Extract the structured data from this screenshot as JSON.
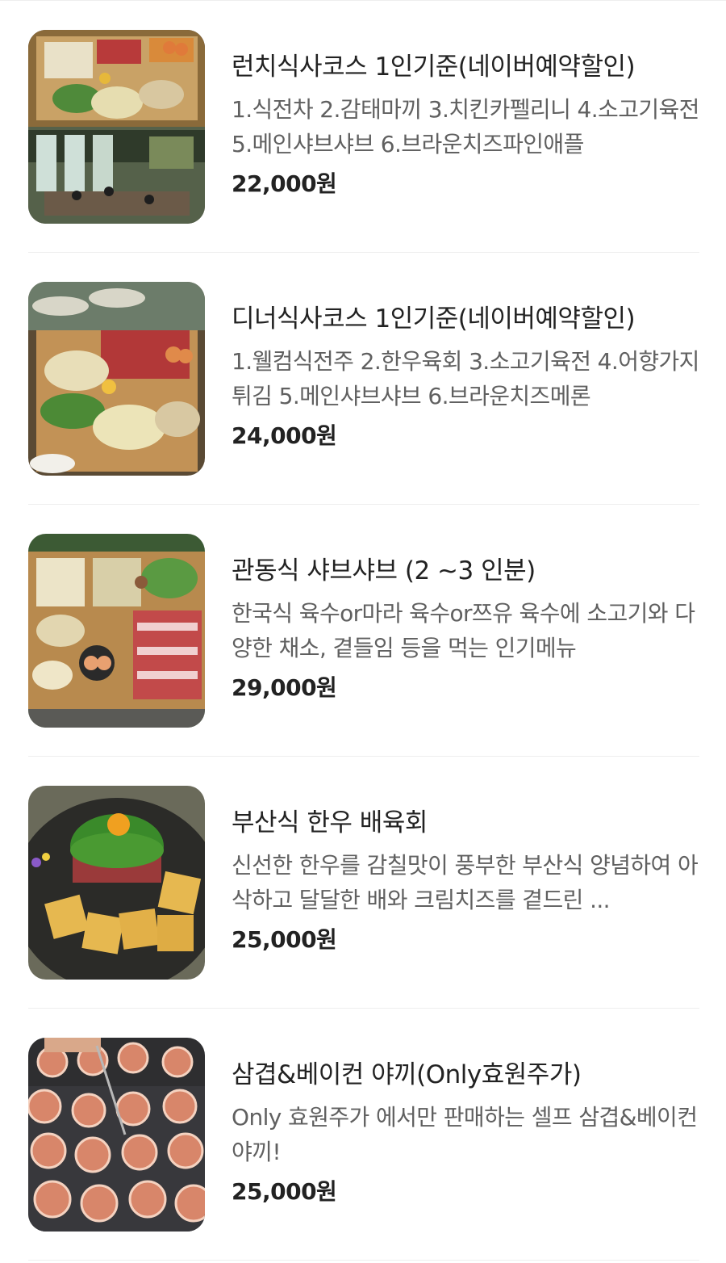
{
  "menu": {
    "items": [
      {
        "title": "런치식사코스 1인기준(네이버예약할인)",
        "description": "1.식전차 2.감태마끼 3.치킨카펠리니 4.소고기육전 5.메인샤브샤브 6.브라운치즈파인애플",
        "price": "22,000원",
        "image": "lunch-course-photo"
      },
      {
        "title": "디너식사코스 1인기준(네이버예약할인)",
        "description": "1.웰컴식전주 2.한우육회 3.소고기육전 4.어향가지튀김 5.메인샤브샤브 6.브라운치즈메론",
        "price": "24,000원",
        "image": "dinner-course-photo"
      },
      {
        "title": "관동식 샤브샤브 (2 ~3 인분)",
        "description": "한국식 육수or마라 육수or쯔유 육수에 소고기와 다양한 채소, 곁들임 등을 먹는 인기메뉴",
        "price": "29,000원",
        "image": "shabu-shabu-photo"
      },
      {
        "title": "부산식 한우 배육회",
        "description": "신선한 한우를 감칠맛이 풍부한 부산식 양념하여 아삭하고 달달한 배와 크림치즈를 곁드린 ...",
        "price": "25,000원",
        "image": "yukhoe-photo"
      },
      {
        "title": "삼겹&베이컨 야끼(Only효원주가)",
        "description": "Only 효원주가 에서만 판매하는 셀프 삼겹&베이컨 야끼!",
        "price": "25,000원",
        "image": "bacon-yaki-photo"
      }
    ]
  }
}
